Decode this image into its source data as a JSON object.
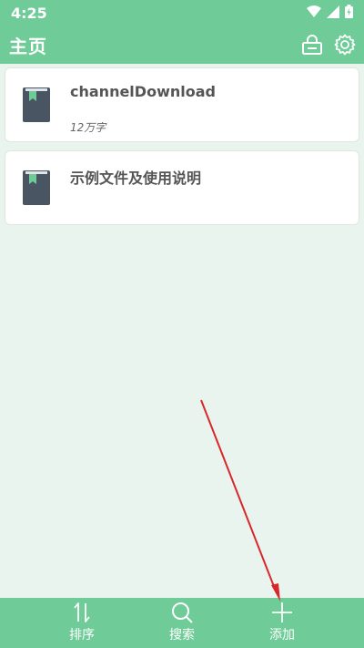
{
  "status_bar": {
    "time": "4:25"
  },
  "app_bar": {
    "title": "主页"
  },
  "books": [
    {
      "title": "channelDownload",
      "subtitle": "12万字"
    },
    {
      "title": "示例文件及使用说明",
      "subtitle": ""
    }
  ],
  "bottom_nav": {
    "items": [
      {
        "label": "排序",
        "icon": "sort-icon"
      },
      {
        "label": "搜索",
        "icon": "search-icon"
      },
      {
        "label": "添加",
        "icon": "plus-icon"
      }
    ]
  },
  "colors": {
    "accent": "#6fcc98",
    "background": "#eaf4ee",
    "book_cover": "#4a5563",
    "bookmark": "#6fcc98",
    "annotation_arrow": "#d9262b"
  }
}
